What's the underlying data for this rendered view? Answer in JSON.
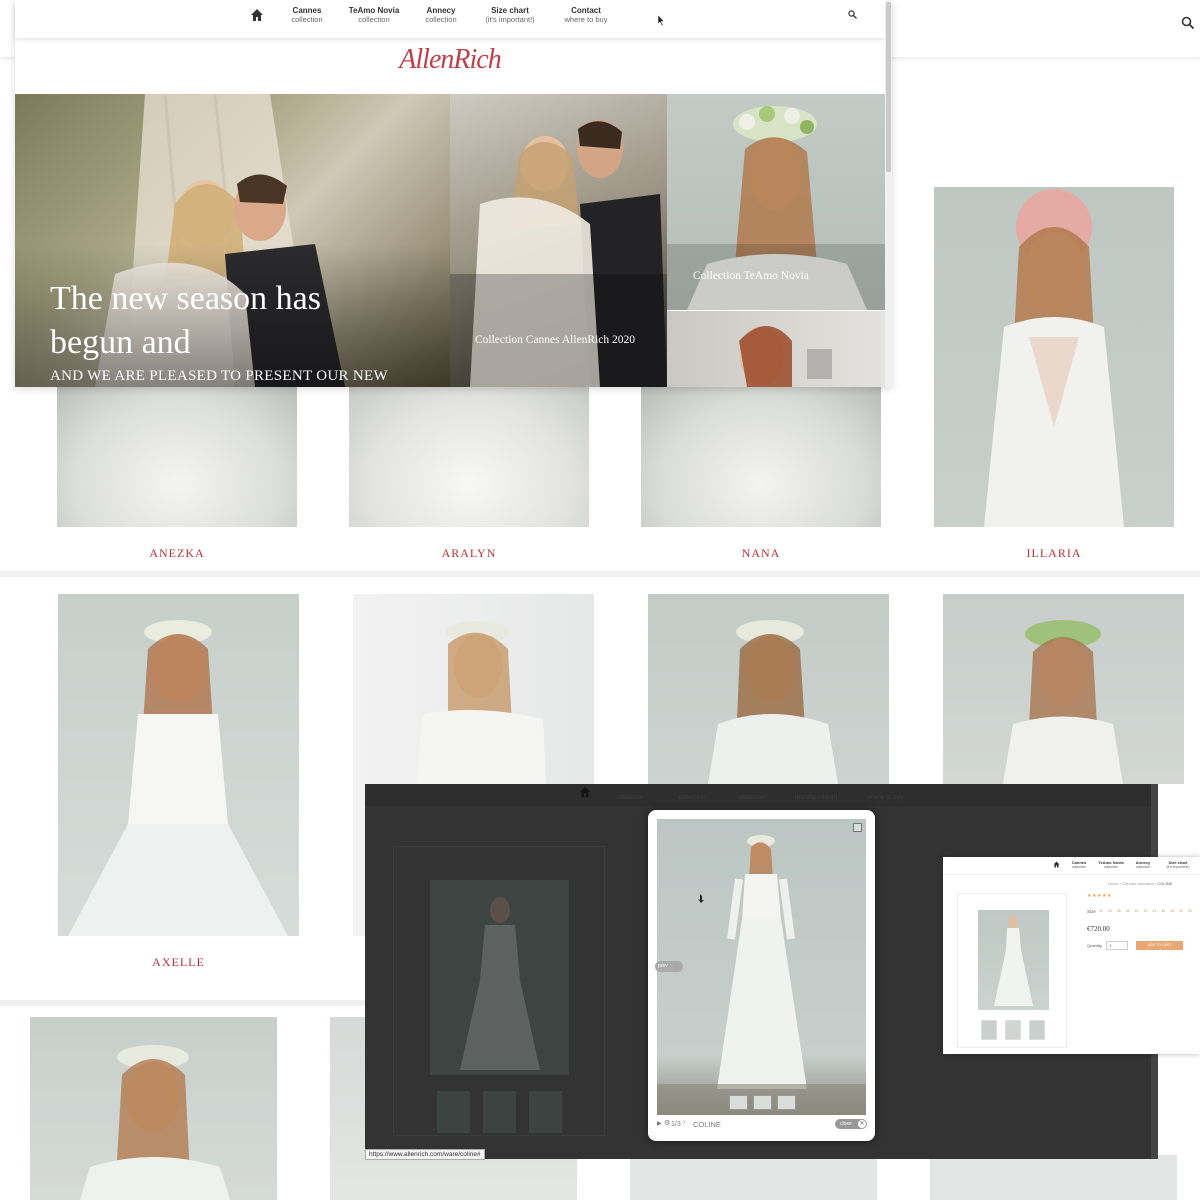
{
  "nav": {
    "items": [
      {
        "title": "Cannes",
        "sub": "collection"
      },
      {
        "title": "TeAmo Novia",
        "sub": "collection"
      },
      {
        "title": "Annecy",
        "sub": "collection"
      },
      {
        "title": "Size chart",
        "sub": "(it's important!)"
      },
      {
        "title": "Contact",
        "sub": "where to buy"
      }
    ]
  },
  "brand": {
    "logo_text": "AllenRich"
  },
  "hero": {
    "headline_line1": "The new season has",
    "headline_line2": "begun and",
    "subline": "AND WE ARE PLEASED TO PRESENT OUR NEW",
    "card_cannes": "Collection Cannes AllenRich 2020",
    "card_teamo": "Collection TeAmo Novia"
  },
  "products": {
    "row1": [
      "ANEZKA",
      "ARALYN",
      "NANA",
      "ILLARIA"
    ],
    "row2": [
      "AXELLE"
    ]
  },
  "quickview": {
    "counter": "1/3",
    "product_name": "COLINE",
    "close_label": "close",
    "prev_label": "prev",
    "status_url": "https://www.allenrich.com/ware/coline#"
  },
  "product_page": {
    "breadcrumb": [
      "Home",
      "Cannes collection",
      "COLINE"
    ],
    "size_label": "Size",
    "sizes": [
      "32",
      "34",
      "36",
      "38",
      "40",
      "42",
      "44",
      "46",
      "48",
      "50",
      "52"
    ],
    "price": "€720.00",
    "qty_label": "Quantity",
    "qty_value": "1",
    "add_to_cart": "ADD TO CART"
  },
  "colors": {
    "accent": "#b8323a",
    "overlay": "#3a3a3a",
    "cart": "#e9a774"
  }
}
